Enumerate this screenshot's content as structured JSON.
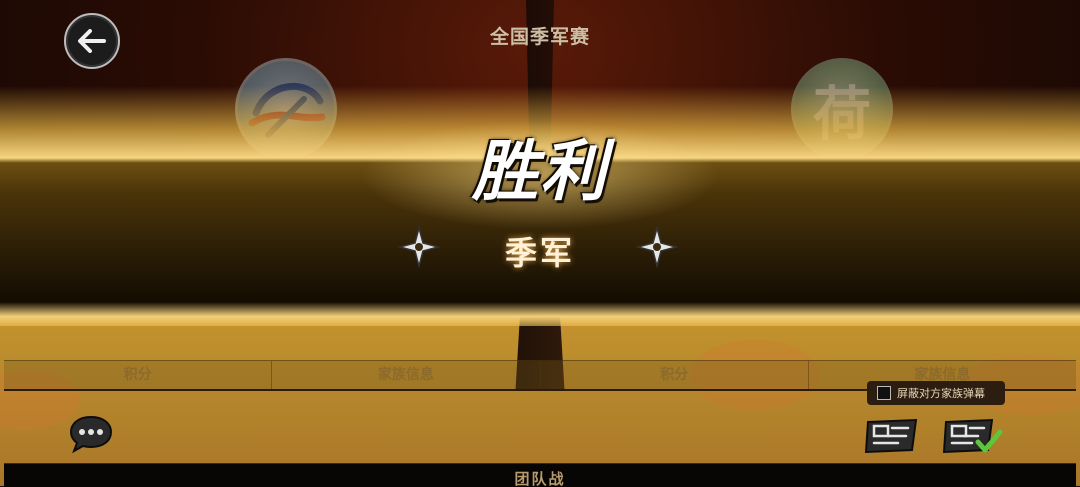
{
  "header": {
    "title": "全国季军赛",
    "back_icon": "back-arrow-icon"
  },
  "result": {
    "victory_text": "胜利",
    "rank_text": "季军"
  },
  "teams": {
    "left_emblem_icon": "team-emblem-swirl",
    "right_emblem_text": "荷"
  },
  "tabs": [
    {
      "label": "积分"
    },
    {
      "label": "家族信息"
    },
    {
      "label": "积分"
    },
    {
      "label": "家族信息"
    }
  ],
  "controls": {
    "block_danmu_label": "屏蔽对方家族弹幕",
    "block_danmu_checked": false,
    "chat_icon": "chat-bubble-icon",
    "danmu_icon": "danmu-send-icon",
    "danmu_check_icon": "danmu-settings-check-icon"
  },
  "footer": {
    "label": "团队战"
  },
  "colors": {
    "banner_gold": "#f6d480",
    "banner_dark": "#2a1d06",
    "accent_green": "#5ec63a"
  }
}
